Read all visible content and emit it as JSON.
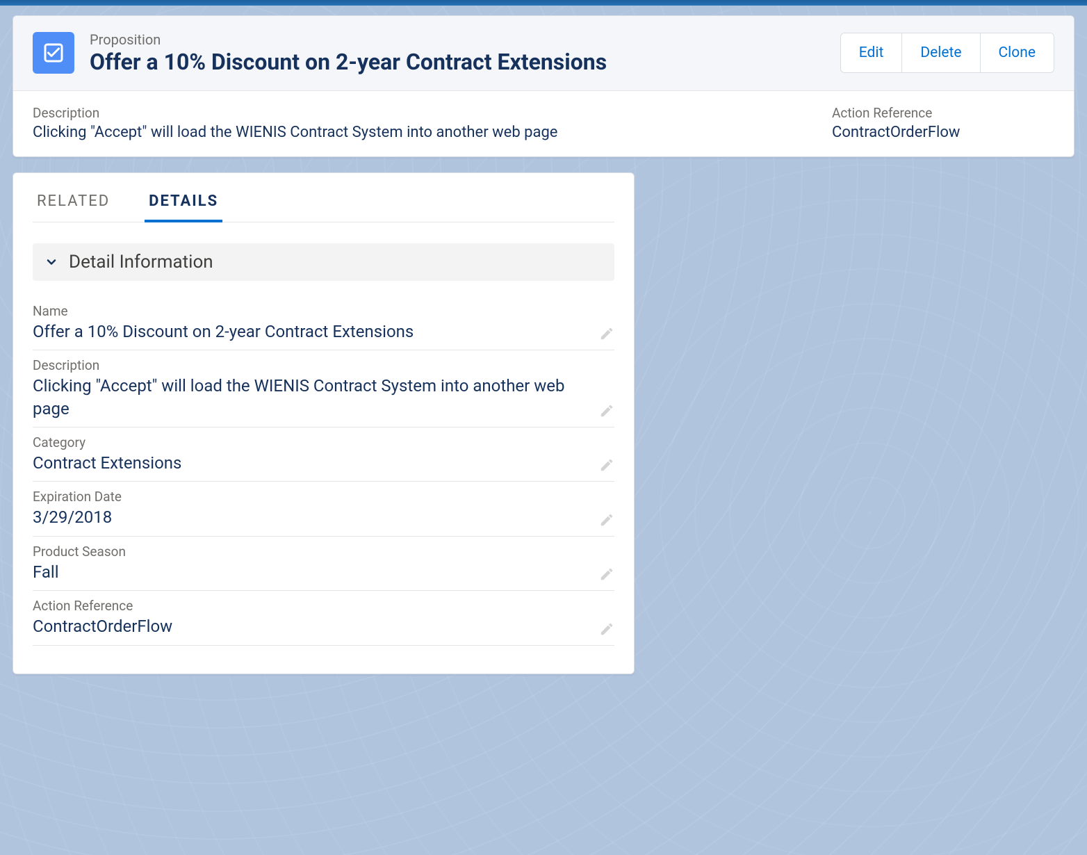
{
  "header": {
    "record_type": "Proposition",
    "title": "Offer a 10% Discount on 2-year Contract Extensions",
    "actions": {
      "edit": "Edit",
      "delete": "Delete",
      "clone": "Clone"
    },
    "summary": {
      "description_label": "Description",
      "description_value": "Clicking \"Accept\" will load the WIENIS Contract System into another web page",
      "action_ref_label": "Action Reference",
      "action_ref_value": "ContractOrderFlow"
    }
  },
  "tabs": {
    "related": "RELATED",
    "details": "DETAILS"
  },
  "section": {
    "title": "Detail Information"
  },
  "fields": {
    "name_label": "Name",
    "name_value": "Offer a 10% Discount on 2-year Contract Extensions",
    "description_label": "Description",
    "description_value": "Clicking \"Accept\" will load the WIENIS Contract System into another web page",
    "category_label": "Category",
    "category_value": "Contract Extensions",
    "expiration_label": "Expiration Date",
    "expiration_value": "3/29/2018",
    "season_label": "Product Season",
    "season_value": "Fall",
    "action_ref_label": "Action Reference",
    "action_ref_value": "ContractOrderFlow"
  }
}
